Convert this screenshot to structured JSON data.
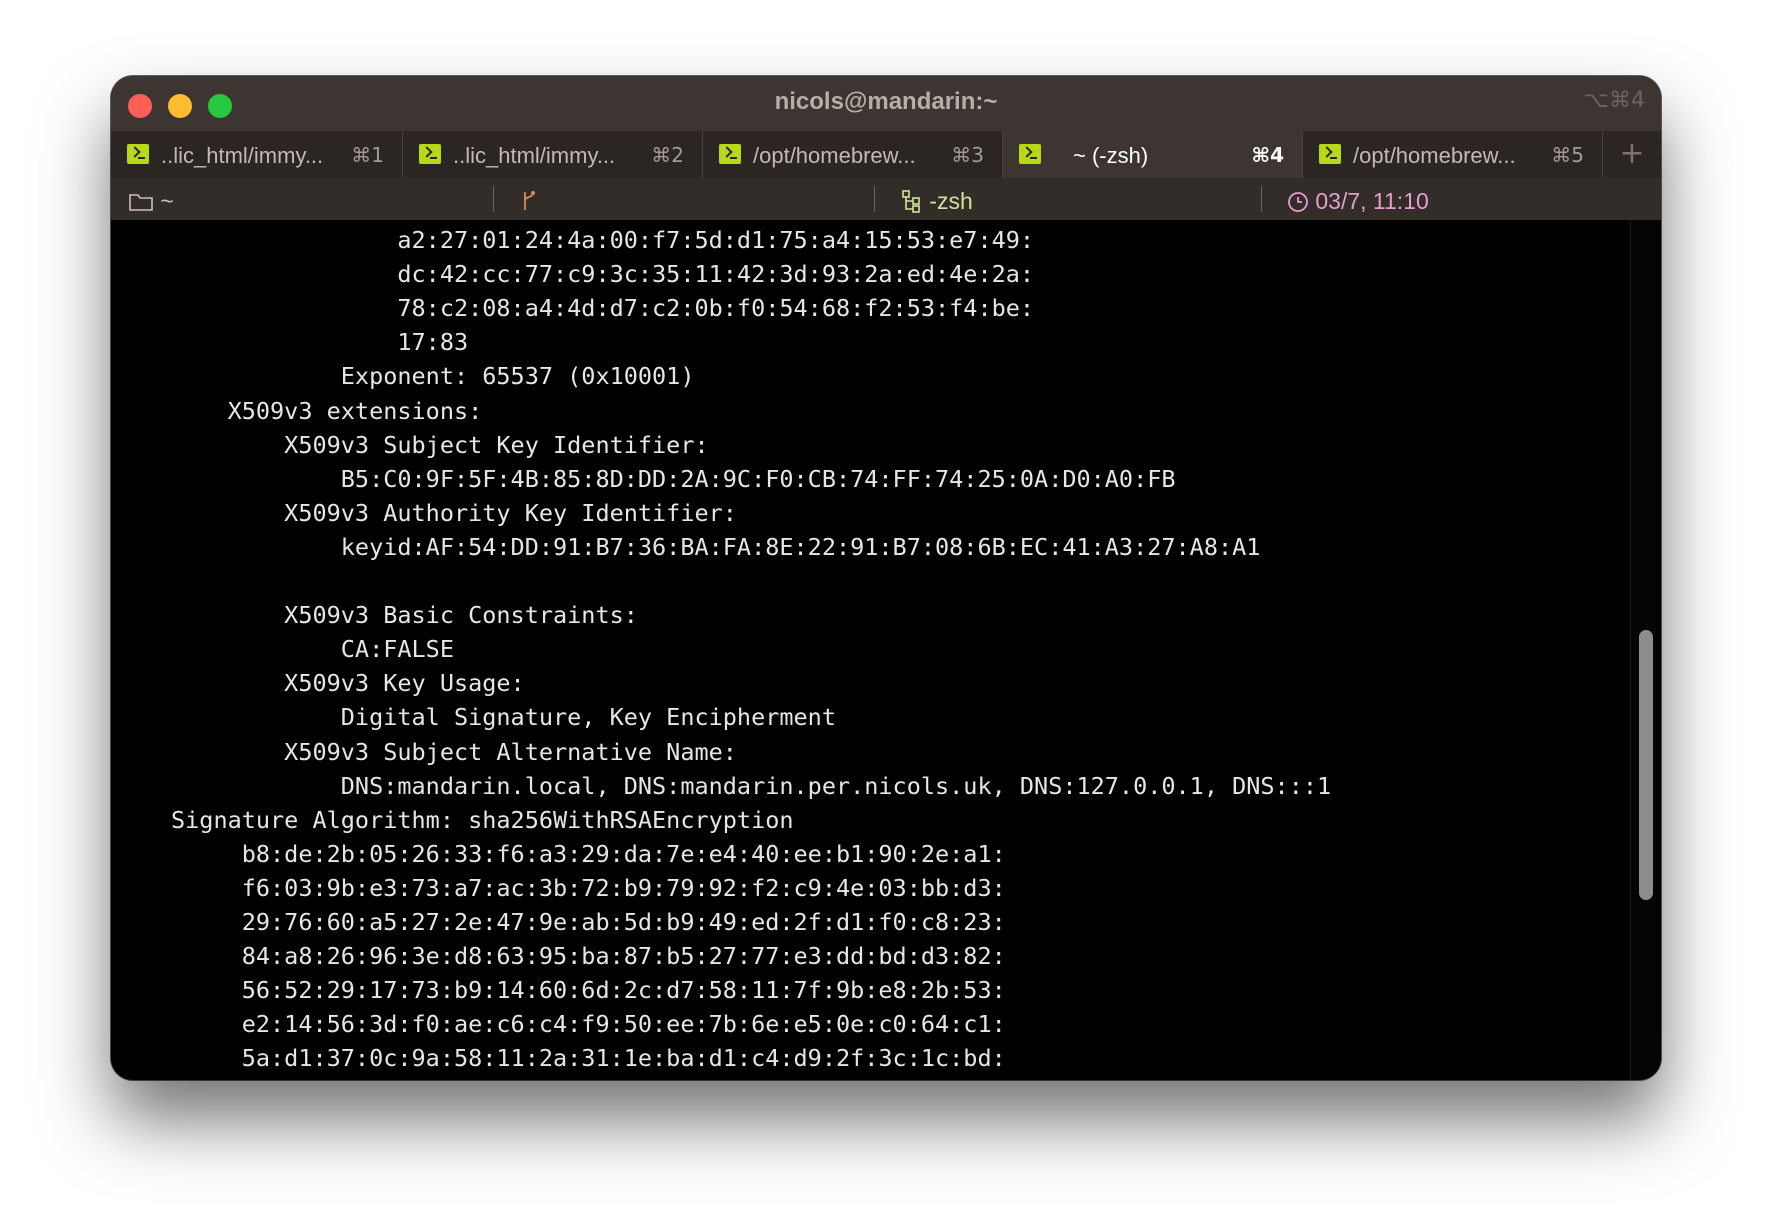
{
  "window": {
    "title": "nicols@mandarin:~",
    "title_shortcut": "⌥⌘4"
  },
  "tabs": [
    {
      "label": "..lic_html/immy...",
      "shortcut": "⌘1",
      "active": false
    },
    {
      "label": "..lic_html/immy...",
      "shortcut": "⌘2",
      "active": false
    },
    {
      "label": "/opt/homebrew...",
      "shortcut": "⌘3",
      "active": false
    },
    {
      "label": "~ (-zsh)",
      "shortcut": "⌘4",
      "active": true
    },
    {
      "label": "/opt/homebrew...",
      "shortcut": "⌘5",
      "active": false
    }
  ],
  "tab_add_label": "+",
  "statusbar": {
    "directory": "~",
    "git_icon": "git-branch-icon",
    "process": "-zsh",
    "datetime": "03/7, 11:10"
  },
  "colors": {
    "tab_icon": "#b8d916",
    "git": "#d98a4e",
    "process": "#cfe49a",
    "time": "#e89bd0"
  },
  "terminal": {
    "lines": [
      "                a2:27:01:24:4a:00:f7:5d:d1:75:a4:15:53:e7:49:",
      "                dc:42:cc:77:c9:3c:35:11:42:3d:93:2a:ed:4e:2a:",
      "                78:c2:08:a4:4d:d7:c2:0b:f0:54:68:f2:53:f4:be:",
      "                17:83",
      "            Exponent: 65537 (0x10001)",
      "    X509v3 extensions:",
      "        X509v3 Subject Key Identifier:",
      "            B5:C0:9F:5F:4B:85:8D:DD:2A:9C:F0:CB:74:FF:74:25:0A:D0:A0:FB",
      "        X509v3 Authority Key Identifier:",
      "            keyid:AF:54:DD:91:B7:36:BA:FA:8E:22:91:B7:08:6B:EC:41:A3:27:A8:A1",
      "",
      "        X509v3 Basic Constraints:",
      "            CA:FALSE",
      "        X509v3 Key Usage:",
      "            Digital Signature, Key Encipherment",
      "        X509v3 Subject Alternative Name:",
      "            DNS:mandarin.local, DNS:mandarin.per.nicols.uk, DNS:127.0.0.1, DNS:::1",
      "Signature Algorithm: sha256WithRSAEncryption",
      "     b8:de:2b:05:26:33:f6:a3:29:da:7e:e4:40:ee:b1:90:2e:a1:",
      "     f6:03:9b:e3:73:a7:ac:3b:72:b9:79:92:f2:c9:4e:03:bb:d3:",
      "     29:76:60:a5:27:2e:47:9e:ab:5d:b9:49:ed:2f:d1:f0:c8:23:",
      "     84:a8:26:96:3e:d8:63:95:ba:87:b5:27:77:e3:dd:bd:d3:82:",
      "     56:52:29:17:73:b9:14:60:6d:2c:d7:58:11:7f:9b:e8:2b:53:",
      "     e2:14:56:3d:f0:ae:c6:c4:f9:50:ee:7b:6e:e5:0e:c0:64:c1:",
      "     5a:d1:37:0c:9a:58:11:2a:31:1e:ba:d1:c4:d9:2f:3c:1c:bd:"
    ]
  },
  "scrollbar": {
    "position_fraction": 0.47
  }
}
